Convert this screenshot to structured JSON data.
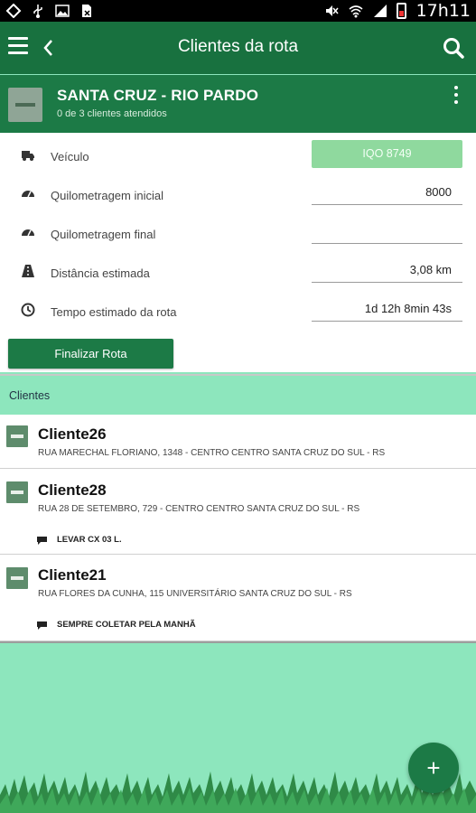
{
  "status_bar": {
    "time": "17h11",
    "icons": [
      "location-icon",
      "usb-icon",
      "image-icon",
      "file-icon",
      "mute-icon",
      "wifi-icon",
      "signal-icon",
      "battery-icon"
    ]
  },
  "app_bar": {
    "title": "Clientes da rota",
    "icons": [
      "menu-icon",
      "back-icon",
      "search-icon"
    ]
  },
  "route": {
    "name": "SANTA CRUZ - RIO PARDO",
    "subtitle": "0 de 3 clientes atendidos"
  },
  "details": {
    "vehicle_label": "Veículo",
    "vehicle_value": "IQO 8749",
    "km_start_label": "Quilometragem inicial",
    "km_start_value": "8000",
    "km_end_label": "Quilometragem final",
    "km_end_value": "",
    "distance_label": "Distância estimada",
    "distance_value": "3,08 km",
    "time_label": "Tempo estimado da rota",
    "time_value": "1d 12h 8min 43s",
    "finalize_label": "Finalizar Rota"
  },
  "clients": {
    "header": "Clientes",
    "items": [
      {
        "name": "Cliente26",
        "address": "RUA MARECHAL FLORIANO, 1348 - CENTRO CENTRO  SANTA CRUZ DO SUL - RS",
        "note": ""
      },
      {
        "name": "Cliente28",
        "address": "RUA 28 DE SETEMBRO, 729 - CENTRO CENTRO  SANTA CRUZ DO SUL - RS",
        "note": "LEVAR CX 03 L."
      },
      {
        "name": "Cliente21",
        "address": "RUA FLORES DA CUNHA, 115 UNIVERSITÁRIO  SANTA CRUZ DO SUL - RS",
        "note": "SEMPRE COLETAR PELA MANHÃ"
      }
    ]
  },
  "fab": {
    "label": "+"
  },
  "colors": {
    "primary": "#18713f",
    "header": "#1c7a46",
    "background": "#8de6bd",
    "vehicle_button": "#8fd99e"
  }
}
